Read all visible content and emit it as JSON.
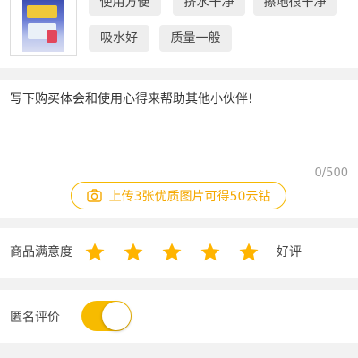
{
  "product": {
    "image_icon": "sponge-mop-package-image"
  },
  "tags": [
    "使用方便",
    "挤水干净",
    "擦地很干净",
    "吸水好",
    "质量一般"
  ],
  "review": {
    "placeholder": "写下购买体会和使用心得来帮助其他小伙伴!",
    "counter": "0/500"
  },
  "upload": {
    "icon": "camera-icon",
    "label": "上传3张优质图片可得50云钻"
  },
  "rating": {
    "label": "商品满意度",
    "stars": 5,
    "max_stars": 5,
    "text": "好评"
  },
  "anonymous": {
    "label": "匿名评价",
    "enabled": true
  },
  "colors": {
    "accent": "#f7bb00",
    "star": "#ffb400",
    "upload_text": "#f5a800",
    "background": "#f2f2f2"
  }
}
